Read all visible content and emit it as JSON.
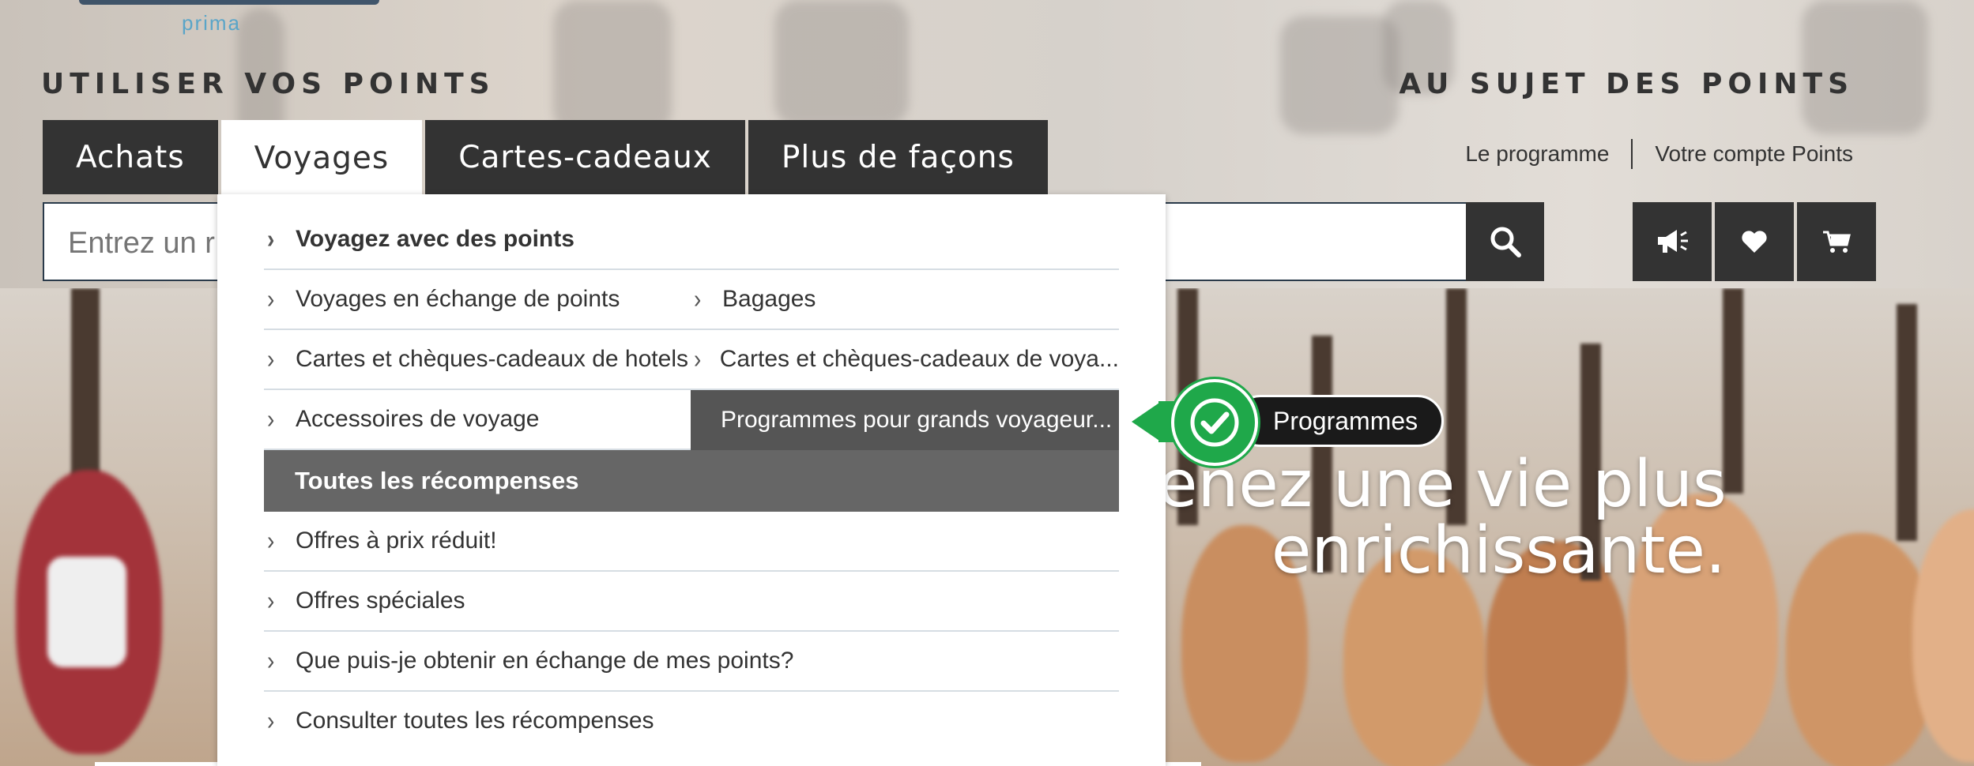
{
  "header": {
    "use_points_title": "UTILISER VOS POINTS",
    "about_points_title": "AU SUJET DES POINTS",
    "about_links": [
      "Le programme",
      "Votre compte Points"
    ]
  },
  "tabs": [
    {
      "label": "Achats",
      "active": false
    },
    {
      "label": "Voyages",
      "active": true
    },
    {
      "label": "Cartes-cadeaux",
      "active": false
    },
    {
      "label": "Plus de façons",
      "active": false
    }
  ],
  "search": {
    "placeholder": "Entrez un r",
    "icon": "search-icon"
  },
  "icon_buttons": [
    "megaphone-icon",
    "heart-icon",
    "cart-icon"
  ],
  "dropdown": {
    "heading": "Voyagez avec des points",
    "items": [
      {
        "label": "Voyages en échange de points"
      },
      {
        "label": "Bagages"
      },
      {
        "label": "Cartes et chèques-cadeaux de hotels"
      },
      {
        "label": "Cartes et chèques-cadeaux de voya..."
      },
      {
        "label": "Accessoires de voyage"
      },
      {
        "label": "Programmes pour grands voyageur...",
        "highlighted": true
      }
    ],
    "section_title": "Toutes les récompenses",
    "section_items": [
      {
        "label": "Offres à prix réduit!"
      },
      {
        "label": "Offres spéciales"
      },
      {
        "label": "Que puis-je obtenir en échange de mes points?"
      },
      {
        "label": "Consulter toutes les récompenses"
      }
    ]
  },
  "hero": {
    "line1": "enez une vie plus",
    "line2": "enrichissante."
  },
  "callout": {
    "label": "Programmes",
    "color": "#1fa84a"
  },
  "logo": {
    "sub": "prima"
  },
  "colors": {
    "tab_bg": "#333333",
    "highlight_bg": "#555555",
    "section_bg": "#666666"
  }
}
